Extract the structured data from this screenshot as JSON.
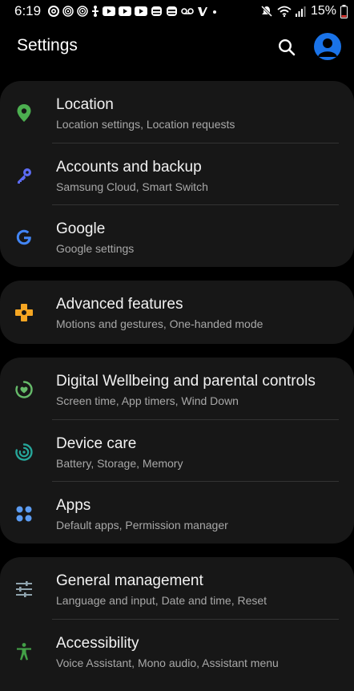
{
  "status_bar": {
    "time": "6:19",
    "battery": "15%",
    "notification_icons": [
      "threads-icon",
      "fingerprint-icon",
      "fingerprint-icon",
      "usb-icon",
      "youtube-icon",
      "youtube-icon",
      "youtube-icon",
      "android-icon",
      "android-icon",
      "voicemail-icon",
      "venmo-icon",
      "dot-icon"
    ],
    "system_icons": [
      "mute-icon",
      "wifi-icon",
      "signal-icon",
      "battery-icon"
    ],
    "battery_color": "#e53935"
  },
  "header": {
    "title": "Settings",
    "search_icon": "search-icon",
    "avatar_icon": "account-icon",
    "avatar_color": "#1a73e8"
  },
  "groups": [
    {
      "items": [
        {
          "title": "Location",
          "subtitle": "Location settings, Location requests",
          "icon": "location-pin-icon",
          "color": "#4caf50"
        },
        {
          "title": "Accounts and backup",
          "subtitle": "Samsung Cloud, Smart Switch",
          "icon": "key-icon",
          "color": "#5c6bf2"
        },
        {
          "title": "Google",
          "subtitle": "Google settings",
          "icon": "google-icon",
          "color": "#4285f4"
        }
      ]
    },
    {
      "items": [
        {
          "title": "Advanced features",
          "subtitle": "Motions and gestures, One-handed mode",
          "icon": "advanced-features-icon",
          "color": "#f5a623"
        }
      ]
    },
    {
      "items": [
        {
          "title": "Digital Wellbeing and parental controls",
          "subtitle": "Screen time, App timers, Wind Down",
          "icon": "wellbeing-icon",
          "color": "#66bb6a"
        },
        {
          "title": "Device care",
          "subtitle": "Battery, Storage, Memory",
          "icon": "device-care-icon",
          "color": "#26a69a"
        },
        {
          "title": "Apps",
          "subtitle": "Default apps, Permission manager",
          "icon": "apps-icon",
          "color": "#5c9cf2"
        }
      ]
    },
    {
      "items": [
        {
          "title": "General management",
          "subtitle": "Language and input, Date and time, Reset",
          "icon": "sliders-icon",
          "color": "#90a4ae"
        },
        {
          "title": "Accessibility",
          "subtitle": "Voice Assistant, Mono audio, Assistant menu",
          "icon": "accessibility-icon",
          "color": "#43a047"
        }
      ]
    }
  ]
}
